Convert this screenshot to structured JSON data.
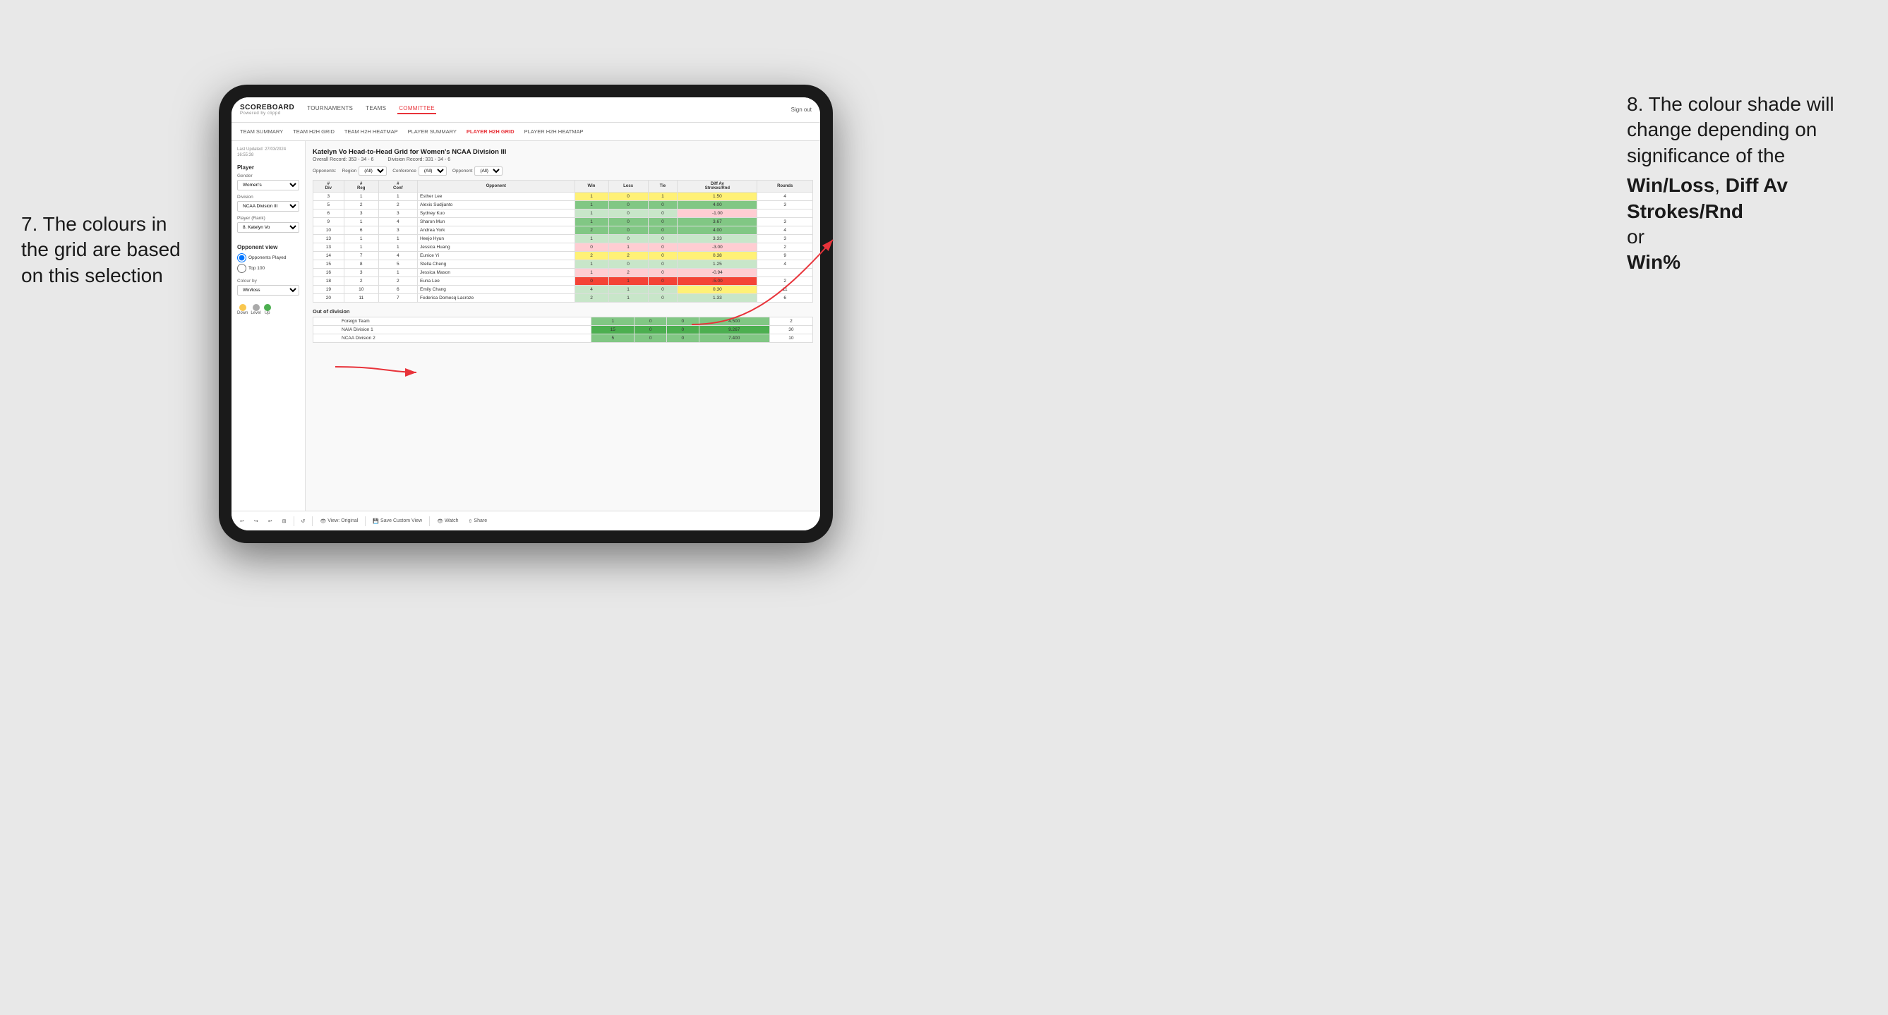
{
  "annotations": {
    "left_title": "7. The colours in the grid are based on this selection",
    "right_title": "8. The colour shade will change depending on significance of the",
    "right_bold1": "Win/Loss",
    "right_bold2": "Diff Av Strokes/Rnd",
    "right_bold3": "Win%",
    "right_connector": "or"
  },
  "nav": {
    "logo": "SCOREBOARD",
    "logo_sub": "Powered by clippd",
    "items": [
      "TOURNAMENTS",
      "TEAMS",
      "COMMITTEE"
    ],
    "active": "COMMITTEE",
    "sign_out": "Sign out"
  },
  "sub_nav": {
    "items": [
      "TEAM SUMMARY",
      "TEAM H2H GRID",
      "TEAM H2H HEATMAP",
      "PLAYER SUMMARY",
      "PLAYER H2H GRID",
      "PLAYER H2H HEATMAP"
    ],
    "active": "PLAYER H2H GRID"
  },
  "left_panel": {
    "last_updated_label": "Last Updated: 27/03/2024",
    "last_updated_time": "16:55:38",
    "player_section": "Player",
    "gender_label": "Gender",
    "gender_value": "Women's",
    "division_label": "Division",
    "division_value": "NCAA Division III",
    "player_rank_label": "Player (Rank)",
    "player_rank_value": "8. Katelyn Vo",
    "opponent_view_label": "Opponent view",
    "radio1": "Opponents Played",
    "radio2": "Top 100",
    "colour_by_label": "Colour by",
    "colour_by_value": "Win/loss",
    "legend_down": "Down",
    "legend_level": "Level",
    "legend_up": "Up"
  },
  "grid": {
    "title": "Katelyn Vo Head-to-Head Grid for Women's NCAA Division III",
    "overall_record_label": "Overall Record:",
    "overall_record": "353 - 34 - 6",
    "division_record_label": "Division Record:",
    "division_record": "331 - 34 - 6",
    "filters": {
      "opponents_label": "Opponents:",
      "region_label": "Region",
      "region_value": "(All)",
      "conference_label": "Conference",
      "conference_value": "(All)",
      "opponent_label": "Opponent",
      "opponent_value": "(All)"
    },
    "table_headers": [
      "#\nDiv",
      "#\nReg",
      "#\nConf",
      "Opponent",
      "Win",
      "Loss",
      "Tie",
      "Diff Av\nStrokes/Rnd",
      "Rounds"
    ],
    "rows": [
      {
        "div": "3",
        "reg": "1",
        "conf": "1",
        "opponent": "Esther Lee",
        "win": "1",
        "loss": "0",
        "tie": "1",
        "diff": "1.50",
        "rounds": "4",
        "win_color": "cell-yellow",
        "diff_color": "cell-yellow"
      },
      {
        "div": "5",
        "reg": "2",
        "conf": "2",
        "opponent": "Alexis Sudjianto",
        "win": "1",
        "loss": "0",
        "tie": "0",
        "diff": "4.00",
        "rounds": "3",
        "win_color": "cell-green-medium",
        "diff_color": "cell-green-medium"
      },
      {
        "div": "6",
        "reg": "3",
        "conf": "3",
        "opponent": "Sydney Kuo",
        "win": "1",
        "loss": "0",
        "tie": "0",
        "diff": "-1.00",
        "rounds": "",
        "win_color": "cell-green-light",
        "diff_color": "cell-red-light"
      },
      {
        "div": "9",
        "reg": "1",
        "conf": "4",
        "opponent": "Sharon Mun",
        "win": "1",
        "loss": "0",
        "tie": "0",
        "diff": "3.67",
        "rounds": "3",
        "win_color": "cell-green-medium",
        "diff_color": "cell-green-medium"
      },
      {
        "div": "10",
        "reg": "6",
        "conf": "3",
        "opponent": "Andrea York",
        "win": "2",
        "loss": "0",
        "tie": "0",
        "diff": "4.00",
        "rounds": "4",
        "win_color": "cell-green-medium",
        "diff_color": "cell-green-medium"
      },
      {
        "div": "13",
        "reg": "1",
        "conf": "1",
        "opponent": "Heejo Hyun",
        "win": "1",
        "loss": "0",
        "tie": "0",
        "diff": "3.33",
        "rounds": "3",
        "win_color": "cell-green-light",
        "diff_color": "cell-green-light"
      },
      {
        "div": "13",
        "reg": "1",
        "conf": "1",
        "opponent": "Jessica Huang",
        "win": "0",
        "loss": "1",
        "tie": "0",
        "diff": "-3.00",
        "rounds": "2",
        "win_color": "cell-red-light",
        "diff_color": "cell-red-light"
      },
      {
        "div": "14",
        "reg": "7",
        "conf": "4",
        "opponent": "Eunice Yi",
        "win": "2",
        "loss": "2",
        "tie": "0",
        "diff": "0.38",
        "rounds": "9",
        "win_color": "cell-yellow",
        "diff_color": "cell-yellow"
      },
      {
        "div": "15",
        "reg": "8",
        "conf": "5",
        "opponent": "Stella Cheng",
        "win": "1",
        "loss": "0",
        "tie": "0",
        "diff": "1.25",
        "rounds": "4",
        "win_color": "cell-green-light",
        "diff_color": "cell-green-light"
      },
      {
        "div": "16",
        "reg": "3",
        "conf": "1",
        "opponent": "Jessica Mason",
        "win": "1",
        "loss": "2",
        "tie": "0",
        "diff": "-0.94",
        "rounds": "",
        "win_color": "cell-red-light",
        "diff_color": "cell-red-light"
      },
      {
        "div": "18",
        "reg": "2",
        "conf": "2",
        "opponent": "Euna Lee",
        "win": "0",
        "loss": "1",
        "tie": "0",
        "diff": "-5.00",
        "rounds": "2",
        "win_color": "cell-red-dark",
        "diff_color": "cell-red-dark"
      },
      {
        "div": "19",
        "reg": "10",
        "conf": "6",
        "opponent": "Emily Chang",
        "win": "4",
        "loss": "1",
        "tie": "0",
        "diff": "0.30",
        "rounds": "11",
        "win_color": "cell-green-light",
        "diff_color": "cell-yellow"
      },
      {
        "div": "20",
        "reg": "11",
        "conf": "7",
        "opponent": "Federica Domecq Lacroze",
        "win": "2",
        "loss": "1",
        "tie": "0",
        "diff": "1.33",
        "rounds": "6",
        "win_color": "cell-green-light",
        "diff_color": "cell-green-light"
      }
    ],
    "out_of_division_label": "Out of division",
    "out_of_division_rows": [
      {
        "opponent": "Foreign Team",
        "win": "1",
        "loss": "0",
        "tie": "0",
        "diff": "4.500",
        "rounds": "2",
        "win_color": "cell-green-medium",
        "diff_color": "cell-green-medium"
      },
      {
        "opponent": "NAIA Division 1",
        "win": "15",
        "loss": "0",
        "tie": "0",
        "diff": "9.267",
        "rounds": "30",
        "win_color": "cell-green-dark",
        "diff_color": "cell-green-dark"
      },
      {
        "opponent": "NCAA Division 2",
        "win": "5",
        "loss": "0",
        "tie": "0",
        "diff": "7.400",
        "rounds": "10",
        "win_color": "cell-green-medium",
        "diff_color": "cell-green-medium"
      }
    ]
  },
  "toolbar": {
    "view_original": "View: Original",
    "save_custom": "Save Custom View",
    "watch": "Watch",
    "share": "Share"
  }
}
